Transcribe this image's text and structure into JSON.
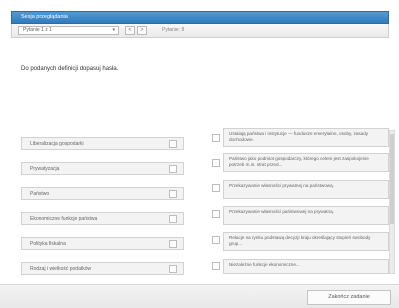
{
  "window": {
    "title": "Sesja przeglądania"
  },
  "nav": {
    "question_select": "Pytanie 1 z 1",
    "prev_label": "<",
    "next_label": ">",
    "question_count": "Pytanie: 8"
  },
  "instruction": "Do podanych definicji dopasuj hasła.",
  "terms": [
    "Liberalizacja gospodarki",
    "Prywatyzacja",
    "Państwo",
    "Ekonomiczne funkcje państwa",
    "Polityka fiskalna",
    "Rodzaj i wielkość podatków"
  ],
  "definitions": [
    "Ustalają państwa i instytucje — fundusze emerytalne, osoby, zasady dochodowe.",
    "Państwo jako podmiot gospodarczy, którego celem jest zaspokojenie potrzeb m.in. strat przed...",
    "Przekazywanie własności prywatnej na państwową.",
    "Przekazywanie własności państwowej na prywatną.",
    "Relacje na rynku podstawą decyzji kraju określający stopień swobody grup...",
    "Niezależne funkcje ekonomiczne..."
  ],
  "footer": {
    "finish_label": "Zakończ zadanie"
  }
}
